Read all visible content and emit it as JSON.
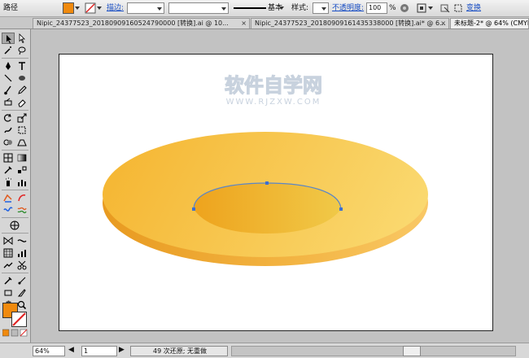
{
  "control_bar": {
    "mode_label": "路径",
    "fill_color": "#f08a0e",
    "stroke_label": "描边:",
    "stroke_style": "基本",
    "style_label": "样式:",
    "opacity_label": "不透明度:",
    "opacity_value": "100",
    "opacity_unit": "%",
    "transform_label": "变换"
  },
  "tabs": [
    {
      "label": "Nipic_24377523_20180909160524790000 [转换].ai @ 10...",
      "active": false
    },
    {
      "label": "Nipic_24377523_20180909161435338000 [转换].ai* @ 6...",
      "active": false
    },
    {
      "label": "未标题-2* @ 64% (CMYK/",
      "active": true
    }
  ],
  "toolbox": {
    "fill_swatch": "#f08a0e",
    "tools": [
      "selection",
      "direct-selection",
      "magic-wand",
      "lasso",
      "pen",
      "type",
      "line-segment",
      "rectangle",
      "paintbrush",
      "pencil",
      "blob-brush",
      "eraser",
      "rotate",
      "scale",
      "warp",
      "free-transform",
      "symbol-sprayer",
      "column-graph",
      "mesh",
      "gradient",
      "eyedropper",
      "blend",
      "live-paint",
      "live-paint-selection",
      "crop",
      "slice",
      "hand",
      "zoom"
    ]
  },
  "canvas": {
    "watermark_main": "软件自学网",
    "watermark_sub": "WWW.RJZXW.COM",
    "plate_colors": [
      "#f5b734",
      "#fad970",
      "#eea31d",
      "#f0c948"
    ]
  },
  "status": {
    "zoom": "64%",
    "artboard": "1",
    "message": "49 次还原; 无重做"
  }
}
